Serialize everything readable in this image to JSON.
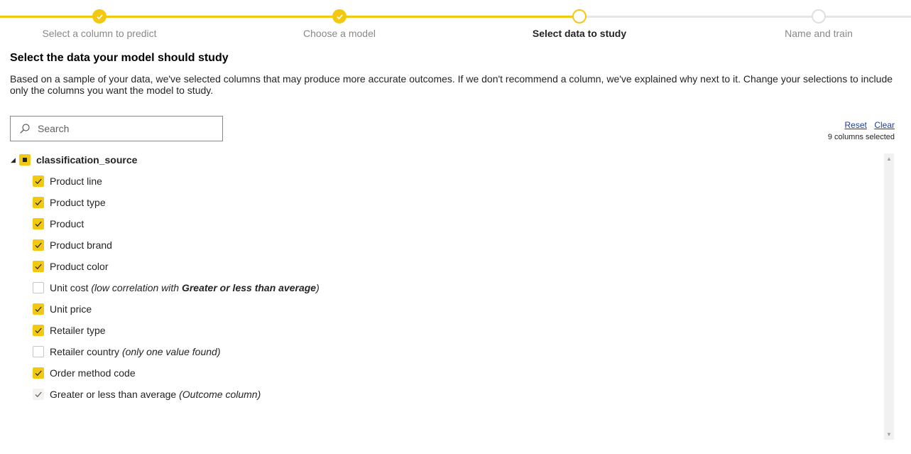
{
  "stepper": {
    "steps": [
      {
        "label": "Select a column to predict",
        "state": "done"
      },
      {
        "label": "Choose a model",
        "state": "done"
      },
      {
        "label": "Select data to study",
        "state": "current"
      },
      {
        "label": "Name and train",
        "state": "todo"
      }
    ]
  },
  "page": {
    "title": "Select the data your model should study",
    "description": "Based on a sample of your data, we've selected columns that may produce more accurate outcomes. If we don't recommend a column, we've explained why next to it. Change your selections to include only the columns you want the model to study."
  },
  "search": {
    "placeholder": "Search",
    "value": ""
  },
  "actions": {
    "reset_label": "Reset",
    "clear_label": "Clear",
    "count_text": "9 columns selected"
  },
  "tree": {
    "group_label": "classification_source",
    "items": [
      {
        "label": "Product line",
        "state": "checked"
      },
      {
        "label": "Product type",
        "state": "checked"
      },
      {
        "label": "Product",
        "state": "checked"
      },
      {
        "label": "Product brand",
        "state": "checked"
      },
      {
        "label": "Product color",
        "state": "checked"
      },
      {
        "label": "Unit cost",
        "state": "unchecked",
        "note_pre": "(low correlation with ",
        "note_bold": "Greater or less than average",
        "note_post": ")"
      },
      {
        "label": "Unit price",
        "state": "checked"
      },
      {
        "label": "Retailer type",
        "state": "checked"
      },
      {
        "label": "Retailer country",
        "state": "unchecked",
        "note_pre": "(only one value found)",
        "note_bold": "",
        "note_post": ""
      },
      {
        "label": "Order method code",
        "state": "checked"
      },
      {
        "label": "Greater or less than average",
        "state": "fixed",
        "note_pre": "(Outcome column)",
        "note_bold": "",
        "note_post": ""
      }
    ]
  },
  "colors": {
    "accent": "#f2c811",
    "text": "#252423",
    "link": "#1f3d99",
    "muted": "#8a8886"
  },
  "icons": {
    "search": "search-icon",
    "check": "check-icon",
    "caret": "caret-down-icon"
  }
}
